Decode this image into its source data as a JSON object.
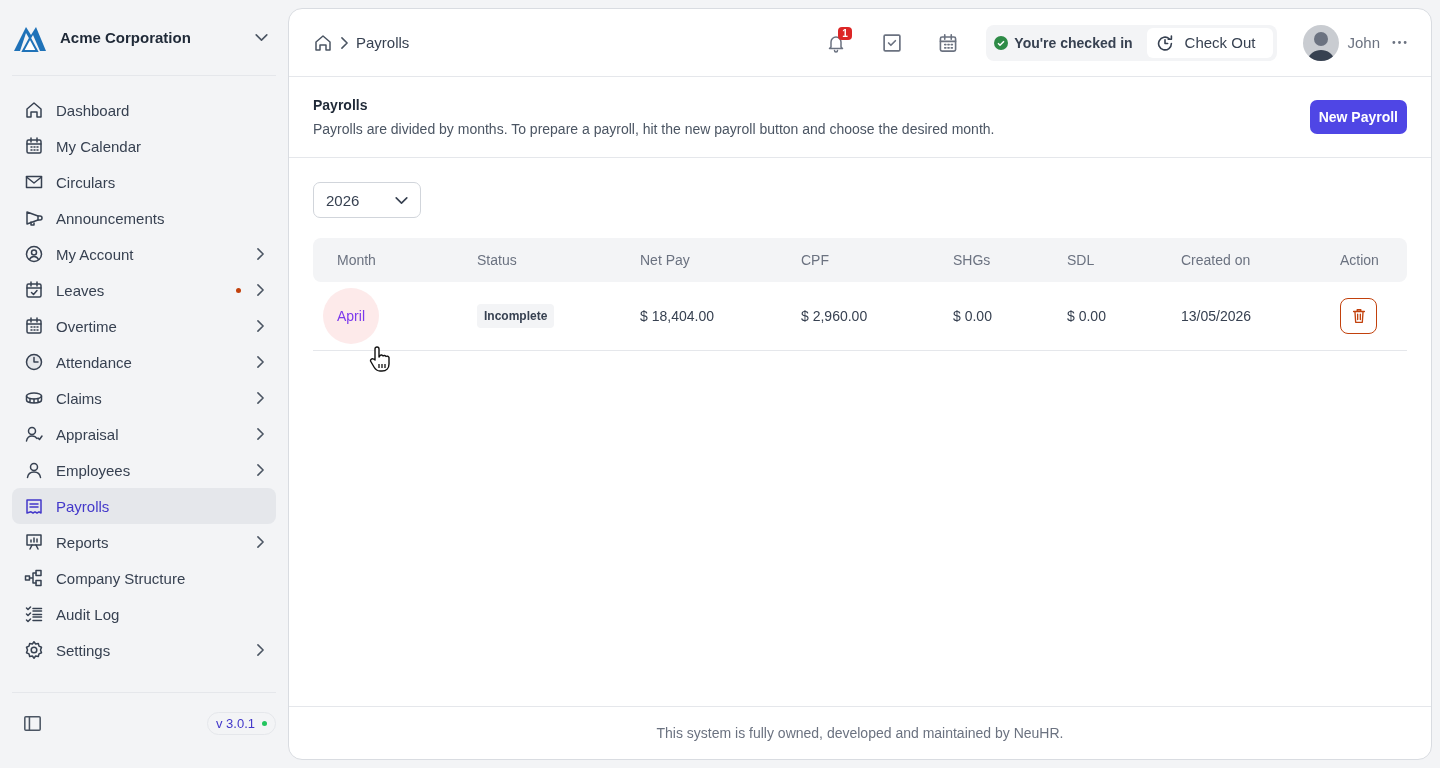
{
  "sidebar": {
    "company": "Acme Corporation",
    "items": [
      {
        "label": "Dashboard",
        "has_submenu": false,
        "dot": false,
        "selected": false
      },
      {
        "label": "My Calendar",
        "has_submenu": false,
        "dot": false,
        "selected": false
      },
      {
        "label": "Circulars",
        "has_submenu": false,
        "dot": false,
        "selected": false
      },
      {
        "label": "Announcements",
        "has_submenu": false,
        "dot": false,
        "selected": false
      },
      {
        "label": "My Account",
        "has_submenu": true,
        "dot": false,
        "selected": false
      },
      {
        "label": "Leaves",
        "has_submenu": true,
        "dot": true,
        "selected": false
      },
      {
        "label": "Overtime",
        "has_submenu": true,
        "dot": false,
        "selected": false
      },
      {
        "label": "Attendance",
        "has_submenu": true,
        "dot": false,
        "selected": false
      },
      {
        "label": "Claims",
        "has_submenu": true,
        "dot": false,
        "selected": false
      },
      {
        "label": "Appraisal",
        "has_submenu": true,
        "dot": false,
        "selected": false
      },
      {
        "label": "Employees",
        "has_submenu": true,
        "dot": false,
        "selected": false
      },
      {
        "label": "Payrolls",
        "has_submenu": false,
        "dot": false,
        "selected": true
      },
      {
        "label": "Reports",
        "has_submenu": true,
        "dot": false,
        "selected": false
      },
      {
        "label": "Company Structure",
        "has_submenu": false,
        "dot": false,
        "selected": false
      },
      {
        "label": "Audit Log",
        "has_submenu": false,
        "dot": false,
        "selected": false
      },
      {
        "label": "Settings",
        "has_submenu": true,
        "dot": false,
        "selected": false
      }
    ],
    "version": "v 3.0.1"
  },
  "header": {
    "breadcrumb": "Payrolls",
    "notification_count": "1",
    "check_status": "You're checked in",
    "check_out_button": "Check Out",
    "user_name": "John"
  },
  "page": {
    "title": "Payrolls",
    "description": "Payrolls are divided by months. To prepare a payroll, hit the new payroll button and choose the desired month.",
    "new_button": "New Payroll"
  },
  "year_select": {
    "value": "2026"
  },
  "table": {
    "columns": [
      "Month",
      "Status",
      "Net Pay",
      "CPF",
      "SHGs",
      "SDL",
      "Created on",
      "Action"
    ],
    "rows": [
      {
        "month": "April",
        "status": "Incomplete",
        "net_pay": "$ 18,404.00",
        "cpf": "$ 2,960.00",
        "shgs": "$ 0.00",
        "sdl": "$ 0.00",
        "created_on": "13/05/2026"
      }
    ]
  },
  "footer": "This system is fully owned, developed and maintained by NeuHR."
}
